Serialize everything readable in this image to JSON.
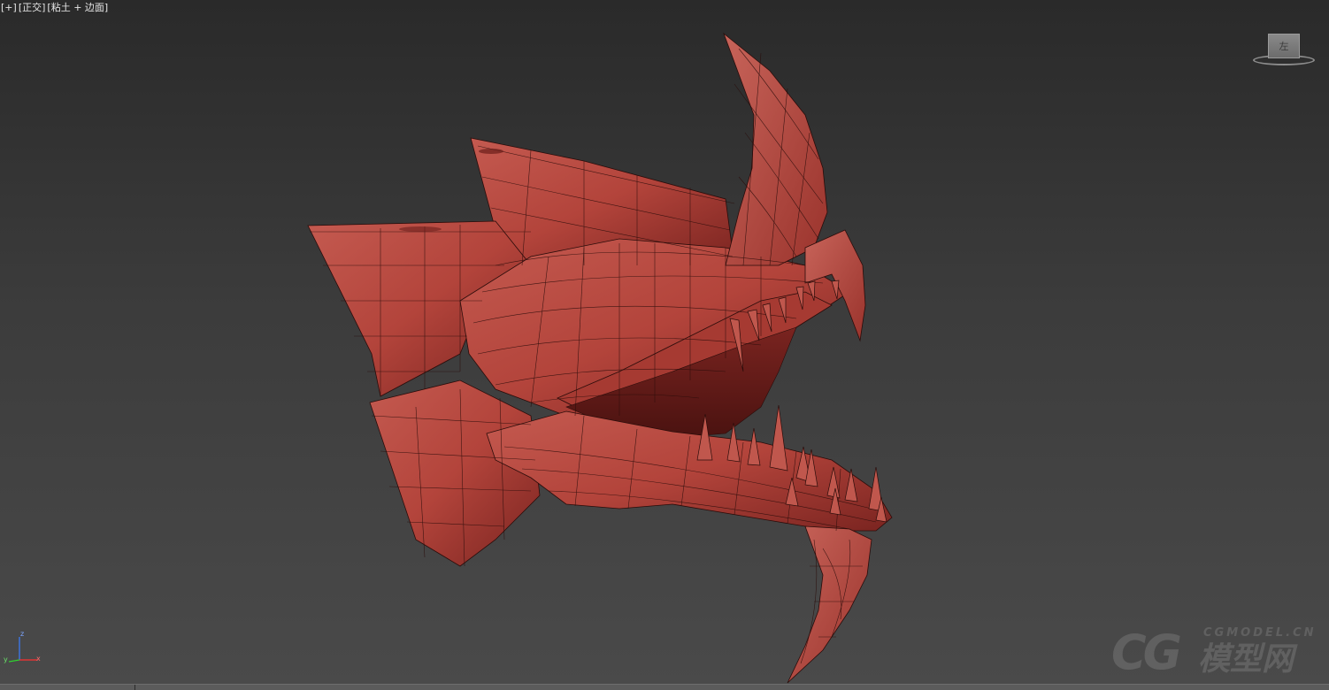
{
  "viewport": {
    "label": {
      "plus": "[+]",
      "view": "[正交]",
      "shading": "[粘土 + 边面]"
    },
    "viewcube_label": "左",
    "axis": {
      "x": "x",
      "y": "y",
      "z": "z"
    }
  },
  "watermark": {
    "logo": "CG",
    "site": "CGMODEL.CN",
    "name": "模型网"
  },
  "colors": {
    "model_fill": "#b8463d",
    "wire": "#2a0c0a",
    "background_top": "#2a2a2a",
    "background_bottom": "#4a4a4a"
  }
}
